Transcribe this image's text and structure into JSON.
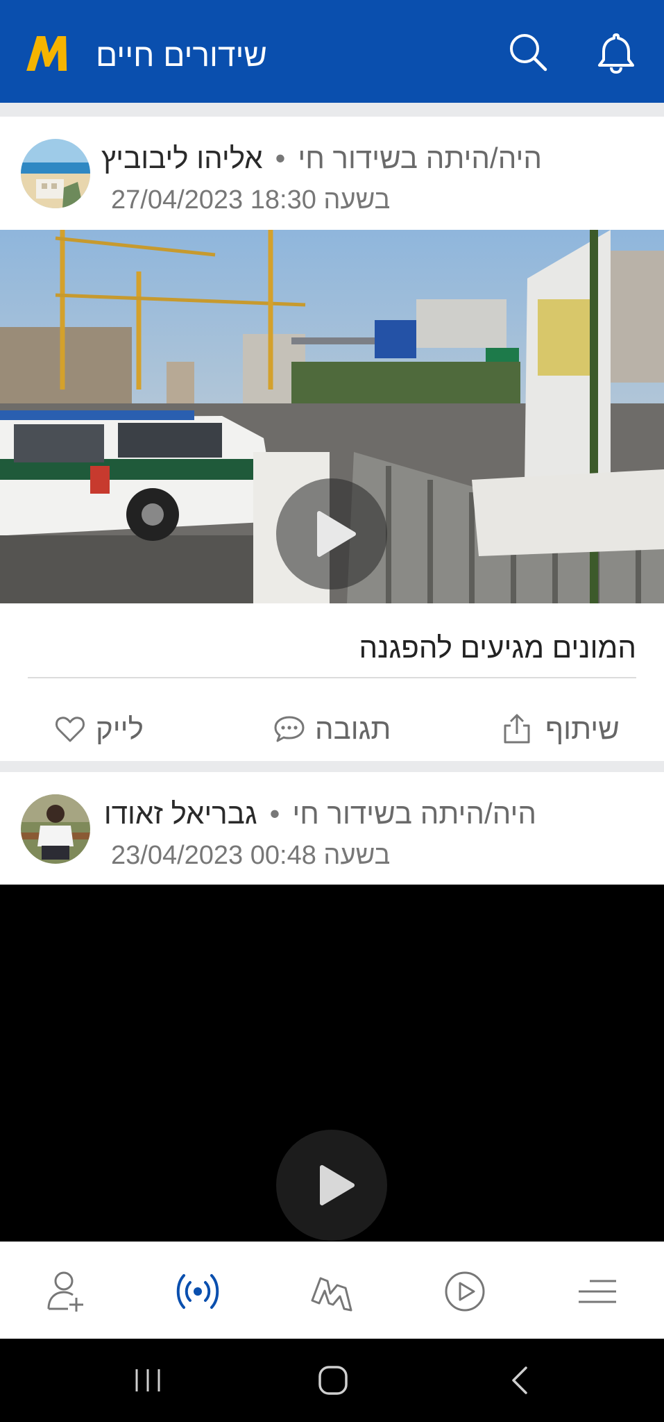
{
  "header": {
    "title": "שידורים חיים",
    "logo_letter": "M",
    "logo_color": "#f5b400",
    "background_color": "#0a4fae",
    "icons": [
      "search-icon",
      "bell-icon"
    ]
  },
  "posts": [
    {
      "author": "אליהו ליבוביץ",
      "status": "היה/היתה בשידור חי",
      "separator": "•",
      "datetime": "27/04/2023 בשעה 18:30",
      "caption": "המונים מגיעים להפגנה",
      "media": "video-thumbnail-street-police-van"
    },
    {
      "author": "גבריאל זאודו",
      "status": "היה/היתה בשידור חי",
      "separator": "•",
      "datetime": "23/04/2023 בשעה 00:48",
      "media": "video-black"
    }
  ],
  "actions": {
    "like": "לייק",
    "reply": "תגובה",
    "share": "שיתוף"
  },
  "bottom_nav": {
    "items": [
      "add-user-icon",
      "live-broadcast-icon",
      "m-logo-icon",
      "play-icon",
      "menu-icon"
    ],
    "active": "live-broadcast-icon",
    "active_color": "#0a4fae"
  },
  "system_nav": [
    "recents-icon",
    "home-icon",
    "back-icon"
  ]
}
